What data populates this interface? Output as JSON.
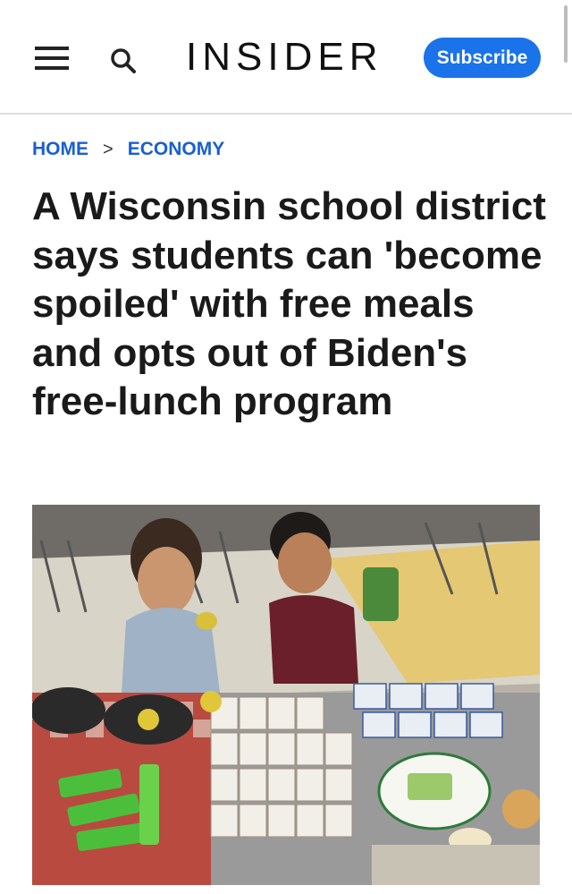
{
  "header": {
    "logo": "INSIDER",
    "subscribe_label": "Subscribe",
    "menu_icon": "hamburger-menu-icon",
    "search_icon": "search-icon"
  },
  "breadcrumb": {
    "home": "HOME",
    "section": "ECONOMY",
    "separator": ">"
  },
  "article": {
    "headline": "A Wisconsin school district says students can 'become spoiled' with free meals and opts out of Biden's free-lunch program"
  },
  "colors": {
    "accent": "#1a73e8",
    "breadcrumb": "#1a5fd1",
    "text": "#1a1a1a"
  }
}
